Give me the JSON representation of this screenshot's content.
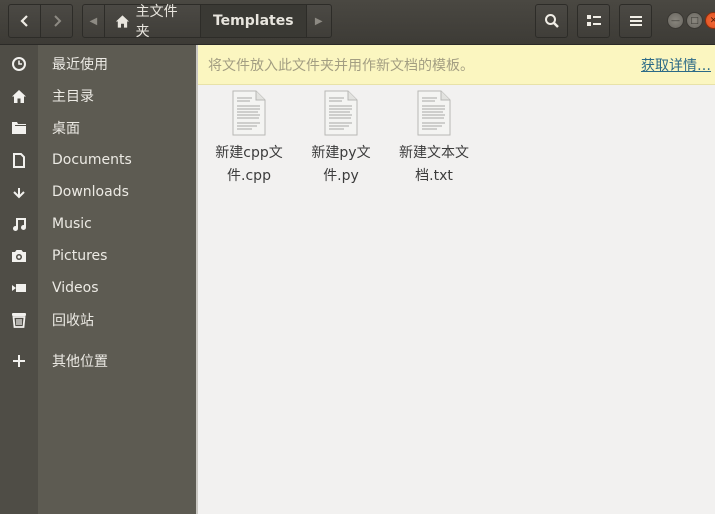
{
  "header": {
    "back_icon": "chevron-left-icon",
    "forward_icon": "chevron-right-icon",
    "path_home_label": "主文件夹",
    "path_current_label": "Templates",
    "search_icon": "search-icon",
    "view_icon": "view-list-icon",
    "menu_icon": "hamburger-menu-icon",
    "window_controls": [
      "minimize",
      "maximize",
      "close"
    ]
  },
  "sidebar": {
    "items": [
      {
        "label": "最近使用",
        "icon": "clock-icon"
      },
      {
        "label": "主目录",
        "icon": "home-icon"
      },
      {
        "label": "桌面",
        "icon": "folder-icon"
      },
      {
        "label": "Documents",
        "icon": "document-icon"
      },
      {
        "label": "Downloads",
        "icon": "download-icon"
      },
      {
        "label": "Music",
        "icon": "music-icon"
      },
      {
        "label": "Pictures",
        "icon": "camera-icon"
      },
      {
        "label": "Videos",
        "icon": "video-icon"
      },
      {
        "label": "回收站",
        "icon": "trash-icon"
      },
      {
        "label": "其他位置",
        "icon": "plus-icon"
      }
    ]
  },
  "infobar": {
    "message": "将文件放入此文件夹并用作新文档的模板。",
    "link_label": "获取详情…"
  },
  "files": [
    {
      "line1": "新建cpp文",
      "line2": "件.cpp"
    },
    {
      "line1": "新建py文",
      "line2": "件.py"
    },
    {
      "line1": "新建文本文",
      "line2": "档.txt"
    }
  ],
  "colors": {
    "header_bg": "#45433e",
    "sidebar_bg": "#5d5b52",
    "infobar_bg": "#fbf6c0",
    "link": "#2c6a87",
    "close_button": "#e95420"
  }
}
